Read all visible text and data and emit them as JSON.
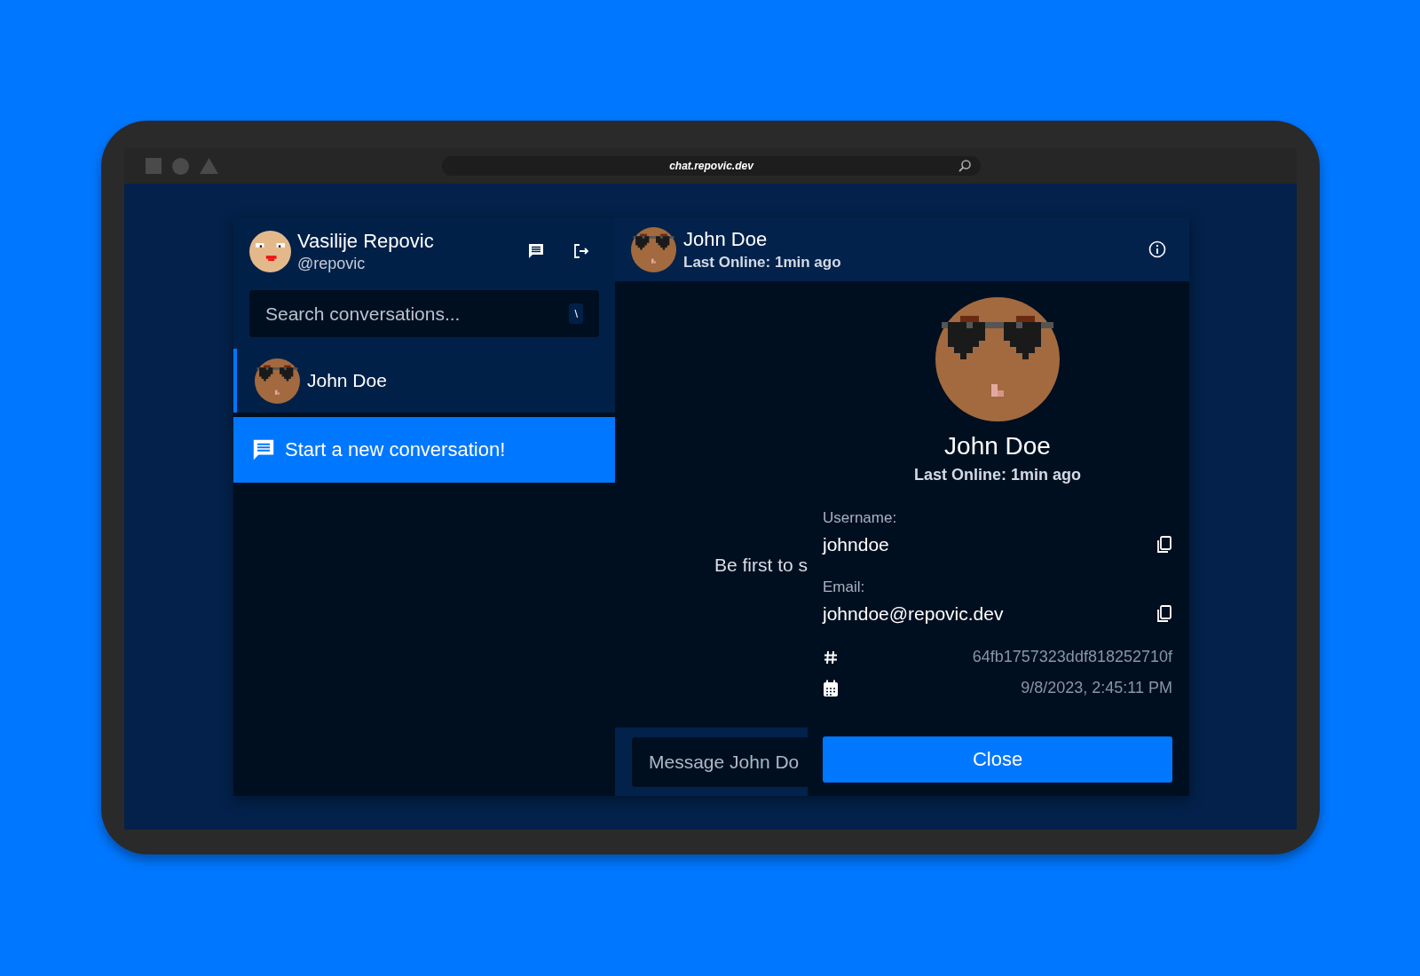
{
  "browser": {
    "url": "chat.repovic.dev"
  },
  "sidebar": {
    "user": {
      "name": "Vasilije Repovic",
      "handle": "@repovic"
    },
    "search": {
      "placeholder": "Search conversations...",
      "shortcut": "\\"
    },
    "conversations": [
      {
        "name": "John Doe",
        "selected": true
      }
    ],
    "new_conversation_button": "Start a new conversation!"
  },
  "chat": {
    "header": {
      "name": "John Doe",
      "status": "Last Online: 1min ago"
    },
    "empty_message": "Be first to s",
    "message_field": {
      "placeholder": "Message John Do"
    }
  },
  "profile_modal": {
    "name": "John Doe",
    "status": "Last Online: 1min ago",
    "fields": [
      {
        "label": "Username:",
        "value": "johndoe"
      },
      {
        "label": "Email:",
        "value": "johndoe@repovic.dev"
      }
    ],
    "meta": [
      {
        "kind": "id",
        "value": "64fb1757323ddf818252710f"
      },
      {
        "kind": "date",
        "value": "9/8/2023, 2:45:11 PM"
      }
    ],
    "close_button": "Close"
  }
}
